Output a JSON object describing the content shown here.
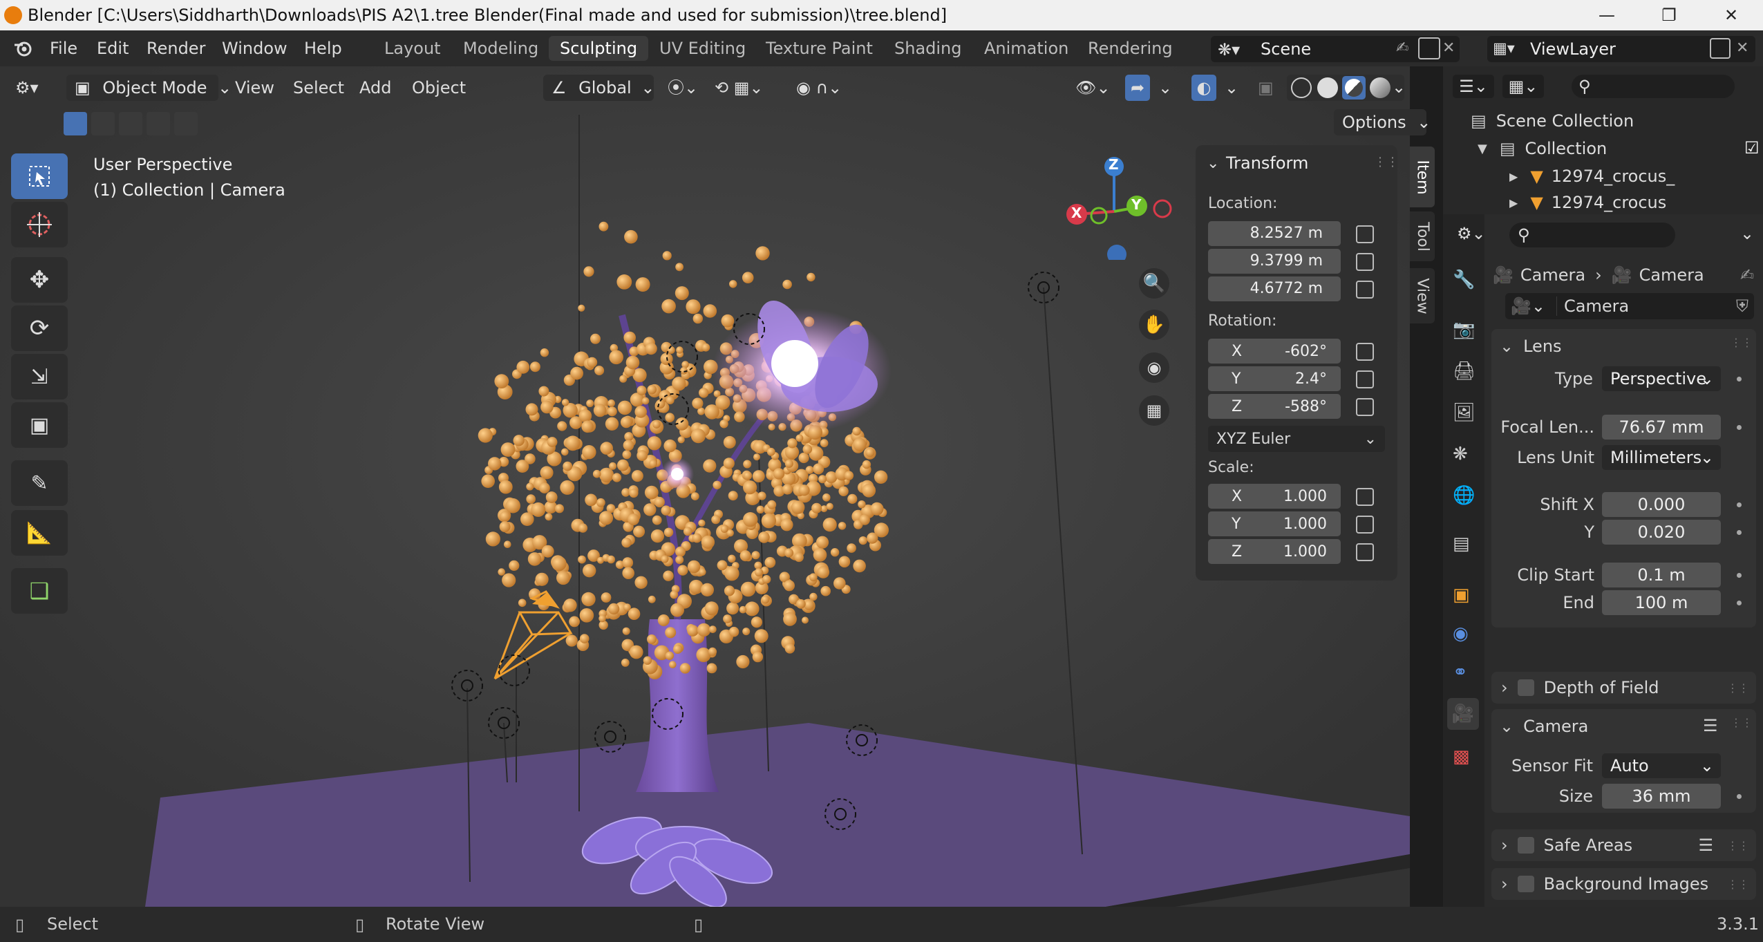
{
  "window": {
    "title": "Blender [C:\\Users\\Siddharth\\Downloads\\PIS A2\\1.tree Blender(Final made and used for submission)\\tree.blend]"
  },
  "menu": {
    "items": [
      "File",
      "Edit",
      "Render",
      "Window",
      "Help"
    ]
  },
  "workspaces": {
    "tabs": [
      "Layout",
      "Modeling",
      "Sculpting",
      "UV Editing",
      "Texture Paint",
      "Shading",
      "Animation",
      "Rendering"
    ],
    "active": "Sculpting"
  },
  "scene": {
    "name": "Scene",
    "view_layer": "ViewLayer"
  },
  "viewport_header": {
    "mode": "Object Mode",
    "menus": [
      "View",
      "Select",
      "Add",
      "Object"
    ],
    "orientation": "Global",
    "options_label": "Options"
  },
  "viewport": {
    "perspective": "User Perspective",
    "context": "(1) Collection | Camera",
    "gizmo": {
      "x": "X",
      "y": "Y",
      "z": "Z"
    }
  },
  "transform": {
    "title": "Transform",
    "location_label": "Location:",
    "location": [
      "8.2527 m",
      "9.3799 m",
      "4.6772 m"
    ],
    "rotation_label": "Rotation:",
    "rotation": [
      {
        "axis": "X",
        "value": "-602°"
      },
      {
        "axis": "Y",
        "value": "2.4°"
      },
      {
        "axis": "Z",
        "value": "-588°"
      }
    ],
    "rotation_mode": "XYZ Euler",
    "scale_label": "Scale:",
    "scale": [
      {
        "axis": "X",
        "value": "1.000"
      },
      {
        "axis": "Y",
        "value": "1.000"
      },
      {
        "axis": "Z",
        "value": "1.000"
      }
    ]
  },
  "sidebar_tabs": [
    "Item",
    "Tool",
    "View"
  ],
  "outliner": {
    "root": "Scene Collection",
    "collection": "Collection",
    "items": [
      "12974_crocus_",
      "12974_crocus"
    ]
  },
  "properties": {
    "breadcrumb": [
      "Camera",
      "Camera"
    ],
    "datablock": "Camera",
    "lens": {
      "title": "Lens",
      "type_label": "Type",
      "type": "Perspective",
      "focal_label": "Focal Len...",
      "focal": "76.67 mm",
      "unit_label": "Lens Unit",
      "unit": "Millimeters",
      "shiftx_label": "Shift X",
      "shiftx": "0.000",
      "shifty_label": "Y",
      "shifty": "0.020",
      "clipstart_label": "Clip Start",
      "clipstart": "0.1 m",
      "clipend_label": "End",
      "clipend": "100 m"
    },
    "dof_title": "Depth of Field",
    "camera": {
      "title": "Camera",
      "sensor_fit_label": "Sensor Fit",
      "sensor_fit": "Auto",
      "size_label": "Size",
      "size": "36 mm"
    },
    "safe_areas_title": "Safe Areas",
    "background_title": "Background Images"
  },
  "statusbar": {
    "select": "Select",
    "rotate": "Rotate View",
    "version": "3.3.1"
  },
  "colors": {
    "accent": "#4772b3",
    "camera_orange": "#f0a030",
    "flower_purple": "#8a70d8",
    "blossom": "#e8a04a"
  }
}
